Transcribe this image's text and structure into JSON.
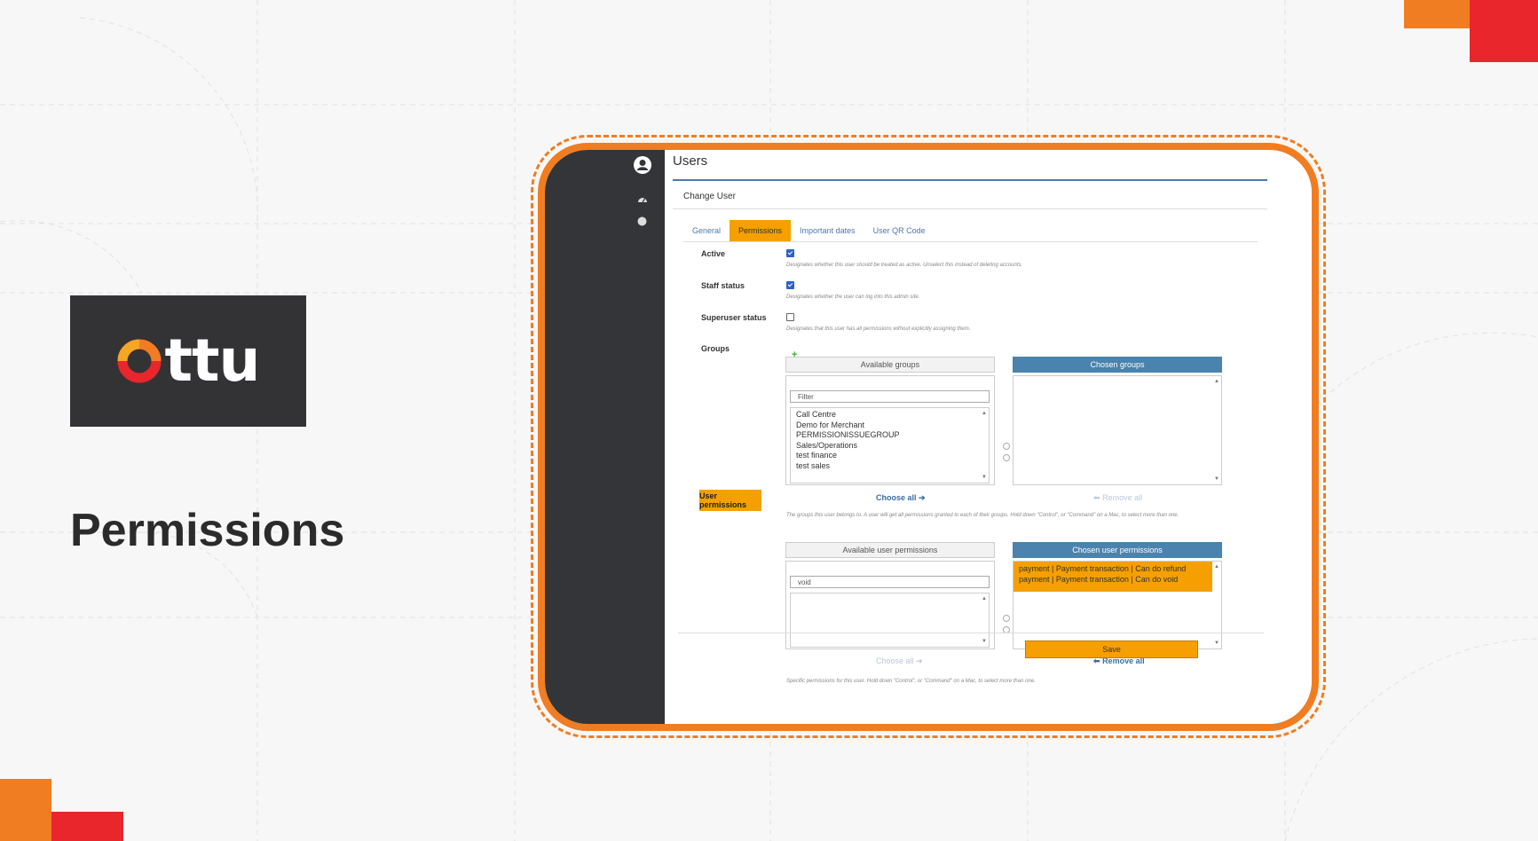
{
  "brand": {
    "logo_text": "Ottu",
    "accent_orange": "#f07d22",
    "accent_red": "#e8262b",
    "logo_bg": "#333336"
  },
  "slide": {
    "title": "Permissions"
  },
  "app": {
    "page_title": "Users",
    "card_title": "Change User",
    "tabs": [
      {
        "label": "General",
        "active": false
      },
      {
        "label": "Permissions",
        "active": true
      },
      {
        "label": "Important dates",
        "active": false
      },
      {
        "label": "User QR Code",
        "active": false
      }
    ],
    "fields": {
      "active": {
        "label": "Active",
        "checked": true,
        "help": "Designates whether this user should be treated as active. Unselect this instead of deleting accounts."
      },
      "staff": {
        "label": "Staff status",
        "checked": true,
        "help": "Designates whether the user can log into this admin site."
      },
      "superuser": {
        "label": "Superuser status",
        "checked": false,
        "help": "Designates that this user has all permissions without explicitly assigning them."
      }
    },
    "groups": {
      "label": "Groups",
      "available_title": "Available groups",
      "chosen_title": "Chosen groups",
      "filter_placeholder": "Filter",
      "available": [
        "Call Centre",
        "Demo for Merchant",
        "PERMISSIONISSUEGROUP",
        "Sales/Operations",
        "test finance",
        "test sales"
      ],
      "chosen": [],
      "choose_all": "Choose all",
      "remove_all": "Remove all",
      "help": "The groups this user belongs to. A user will get all permissions granted to each of their groups. Hold down \"Control\", or \"Command\" on a Mac, to select more than one."
    },
    "user_permissions": {
      "label": "User permissions",
      "available_title": "Available user permissions",
      "chosen_title": "Chosen user permissions",
      "filter_value": "void",
      "available": [],
      "chosen": [
        "payment | Payment transaction | Can do refund",
        "payment | Payment transaction | Can do void"
      ],
      "choose_all": "Choose all",
      "remove_all": "Remove all",
      "help": "Specific permissions for this user. Hold down \"Control\", or \"Command\" on a Mac, to select more than one."
    },
    "save_label": "Save"
  }
}
